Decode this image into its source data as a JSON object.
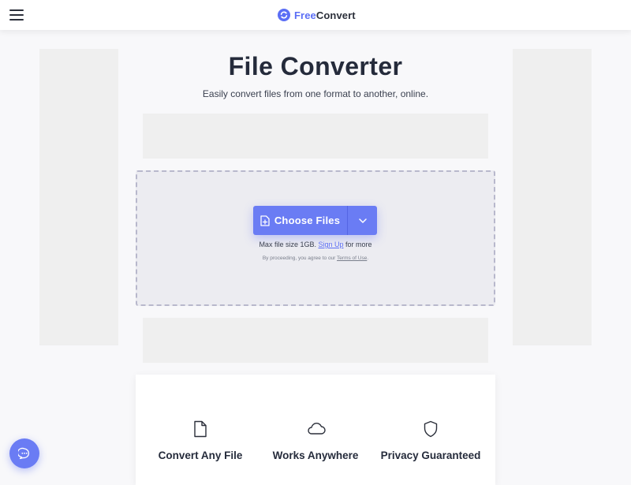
{
  "header": {
    "brand_free": "Free",
    "brand_convert": "Convert",
    "icons": {
      "menu": "hamburger-menu-icon",
      "logo": "freeconvert-logo-icon"
    }
  },
  "hero": {
    "title": "File Converter",
    "subtitle": "Easily convert files from one format to another, online."
  },
  "upload": {
    "choose_label": "Choose Files",
    "max_prefix": "Max file size 1GB.",
    "signup_link": "Sign Up",
    "max_suffix": "for more",
    "terms_prefix": "By proceeding, you agree to our",
    "terms_link": "Terms of Use",
    "terms_suffix": ".",
    "icons": {
      "file": "file-plus-icon",
      "dropdown": "chevron-down-icon"
    }
  },
  "features": [
    {
      "label": "Convert Any File",
      "icon": "file-icon"
    },
    {
      "label": "Works Anywhere",
      "icon": "cloud-icon"
    },
    {
      "label": "Privacy Guaranteed",
      "icon": "shield-icon"
    }
  ],
  "chat": {
    "icon": "chat-bubble-icon"
  },
  "colors": {
    "accent": "#6a7cf4",
    "brand_blue": "#5b6ef5",
    "text_dark": "#252b3b",
    "dropzone_bg": "#ececf1",
    "ad_placeholder": "#efefef"
  }
}
